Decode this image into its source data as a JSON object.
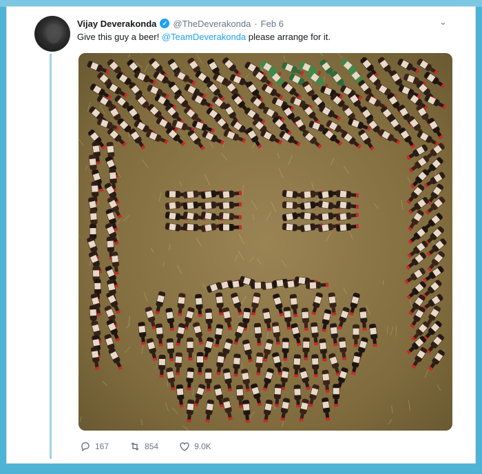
{
  "tweet": {
    "author_name": "Vijay Deverakonda",
    "author_handle": "@TheDeverakonda",
    "separator": "·",
    "date": "Feb 6",
    "text_before_mention": "Give this guy a beer! ",
    "mention": "@TeamDeverakonda",
    "text_after_mention": " please arrange for it.",
    "verified_glyph": "✓",
    "menu_glyph": "⌄"
  },
  "media": {
    "description_icon": "beer-bottle-face-photo"
  },
  "actions": {
    "replies": "167",
    "retweets": "854",
    "likes": "9.0K"
  },
  "colors": {
    "accent": "#1da1f2",
    "frame": "#4fb3d6",
    "thread": "#9fd4ea"
  }
}
